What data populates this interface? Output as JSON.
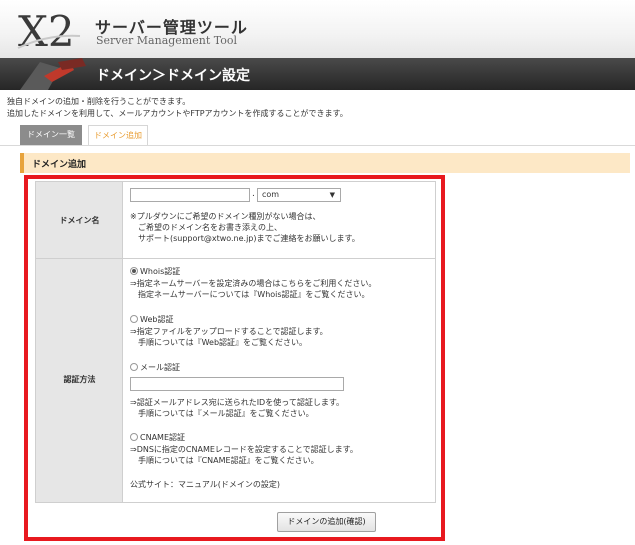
{
  "header": {
    "logo_text": "X2",
    "title": "サーバー管理ツール",
    "subtitle": "Server Management Tool"
  },
  "page": {
    "title": "ドメイン＞ドメイン設定",
    "description": [
      "独自ドメインの追加・削除を行うことができます。",
      "追加したドメインを利用して、メールアカウントやFTPアカウントを作成することができます。"
    ]
  },
  "tabs": [
    {
      "label": "ドメイン一覧",
      "active": false
    },
    {
      "label": "ドメイン追加",
      "active": true
    }
  ],
  "section": {
    "title": "ドメイン追加"
  },
  "form": {
    "domain": {
      "label": "ドメイン名",
      "input_value": "",
      "dot": ".",
      "tld_selected": "com",
      "notes": [
        "※プルダウンにご希望のドメイン種別がない場合は、",
        "　ご希望のドメイン名をお書き添えの上、",
        "　サポート(support@xtwo.ne.jp)までご連絡をお願いします。"
      ]
    },
    "auth": {
      "label": "認証方法",
      "options": [
        {
          "label": "Whois認証",
          "checked": true,
          "notes": [
            "⇒指定ネームサーバーを設定済みの場合はこちらをご利用ください。",
            "　指定ネームサーバーについては『Whois認証』をご覧ください。"
          ]
        },
        {
          "label": "Web認証",
          "checked": false,
          "notes": [
            "⇒指定ファイルをアップロードすることで認証します。",
            "　手順については『Web認証』をご覧ください。"
          ]
        },
        {
          "label": "メール認証",
          "checked": false,
          "email_value": "",
          "notes": [
            "⇒認証メールアドレス宛に送られたIDを使って認証します。",
            "　手順については『メール認証』をご覧ください。"
          ]
        },
        {
          "label": "CNAME認証",
          "checked": false,
          "notes": [
            "⇒DNSに指定のCNAMEレコードを設定することで認証します。",
            "　手順については『CNAME認証』をご覧ください。"
          ]
        }
      ],
      "official_prefix": "公式サイト：",
      "official_link": "マニュアル(ドメインの設定)"
    },
    "submit_label": "ドメインの追加(確認)"
  },
  "colors": {
    "accent": "#e7a33c",
    "section_bg": "#fde8c6",
    "highlight": "#e8191f",
    "title_bar": "#2f2f2f"
  }
}
